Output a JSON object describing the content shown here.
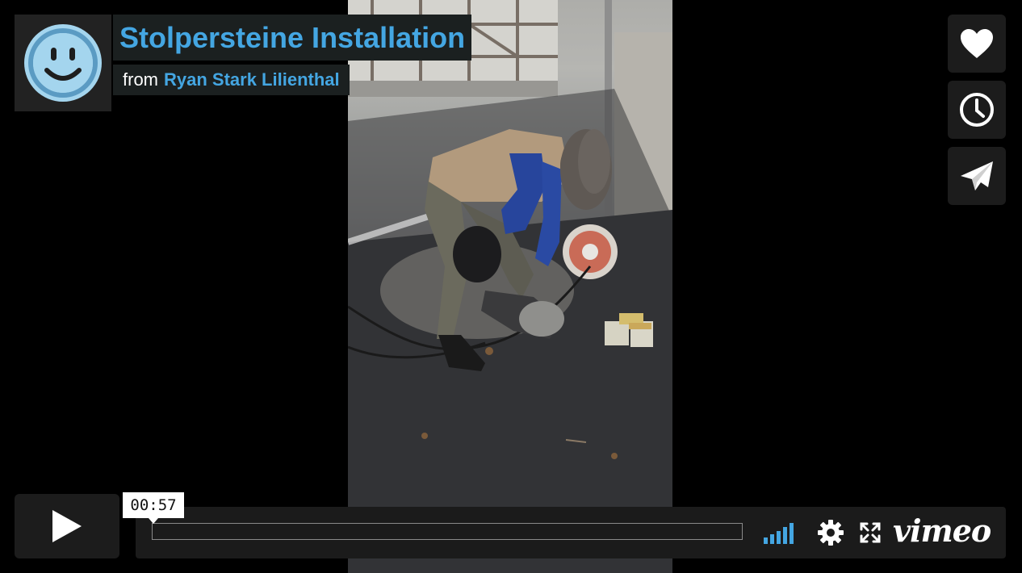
{
  "video": {
    "title": "Stolpersteine Installation",
    "byline_prefix": "from",
    "author": "Ryan Stark Lilienthal",
    "avatar_icon": "smiley-face-icon"
  },
  "side_actions": [
    {
      "name": "like",
      "icon": "heart-icon"
    },
    {
      "name": "watch-later",
      "icon": "clock-icon"
    },
    {
      "name": "share",
      "icon": "paper-plane-icon"
    }
  ],
  "controls": {
    "play_icon": "play-icon",
    "current_time": "00:57",
    "progress_fraction": 0,
    "volume_icon": "volume-bars-icon",
    "settings_icon": "gear-icon",
    "fullscreen_icon": "fullscreen-icon",
    "brand": "vimeo"
  },
  "colors": {
    "accent": "#44a6e2",
    "panel": "#1c1c1c",
    "text": "#ffffff"
  }
}
